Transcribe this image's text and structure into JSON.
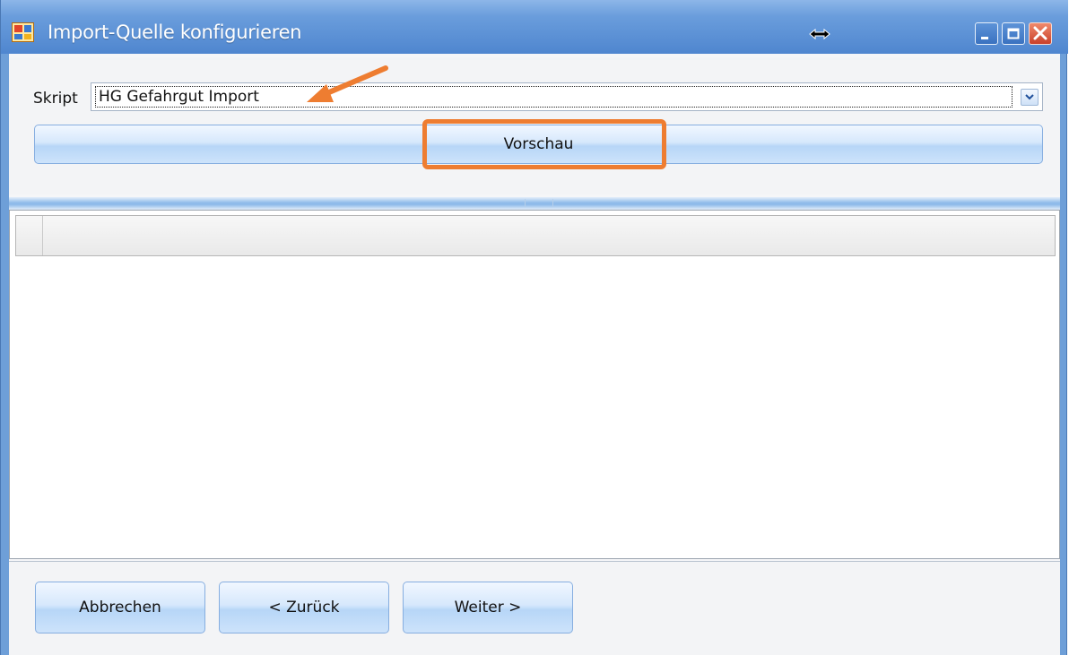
{
  "window": {
    "title": "Import-Quelle konfigurieren",
    "controls": [
      "minimize-icon",
      "maximize-icon",
      "close-icon"
    ]
  },
  "script_selector": {
    "label": "Skript",
    "selected": "HG Gefahrgut Import"
  },
  "preview_button": {
    "label": "Vorschau"
  },
  "grid": {
    "rows": []
  },
  "footer": {
    "cancel_label": "Abbrechen",
    "back_label": "< Zurück",
    "next_label": "Weiter >"
  },
  "colors": {
    "annotation": "#ee7d31",
    "title_bar": "#4f86cf",
    "button_face": "#cde3fb"
  },
  "icons": {
    "app": "app-window-icon",
    "cursor": "horizontal-resize-cursor-icon",
    "dropdown": "chevron-down-icon",
    "annotation_arrow": "annotation-arrow-icon"
  }
}
